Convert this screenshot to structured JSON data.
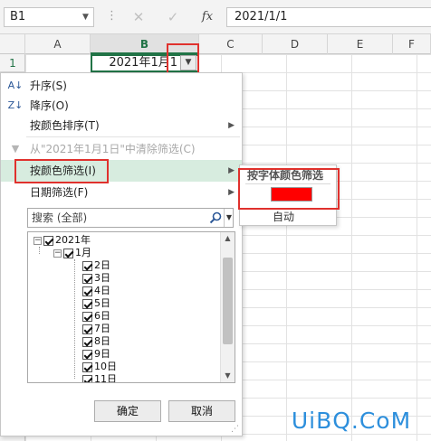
{
  "formula_bar": {
    "name_box": "B1",
    "dots": "⋮",
    "cancel_glyph": "✕",
    "confirm_glyph": "✓",
    "fx_label": "fx",
    "formula_value": "2021/1/1"
  },
  "sheet": {
    "columns": [
      "A",
      "B",
      "C",
      "D",
      "E",
      "F"
    ],
    "selected_column": "B",
    "rows": [
      "1"
    ],
    "active_cell_value": "2021年1月1"
  },
  "dropdown": {
    "items": [
      {
        "label": "升序(S)",
        "icon": "sort-ascending-icon",
        "glyph": "A↓"
      },
      {
        "label": "降序(O)",
        "icon": "sort-descending-icon",
        "glyph": "Z↓"
      },
      {
        "label": "按颜色排序(T)"
      },
      {
        "label": "从\"2021年1月1日\"中清除筛选(C)",
        "icon": "clear-filter-icon",
        "glyph": "▼",
        "disabled": true
      },
      {
        "label": "按颜色筛选(I)",
        "highlighted": true
      },
      {
        "label": "日期筛选(F)"
      }
    ],
    "search_placeholder": "搜索 (全部)",
    "tree": {
      "year": "2021年",
      "month": "1月",
      "days": [
        "2日",
        "3日",
        "4日",
        "5日",
        "6日",
        "7日",
        "8日",
        "9日",
        "10日",
        "11日"
      ]
    },
    "ok_label": "确定",
    "cancel_label": "取消"
  },
  "submenu": {
    "title": "按字体颜色筛选",
    "swatch_color": "#ff0000",
    "auto_label": "自动"
  },
  "watermark": "UiBQ.CoM",
  "colors": {
    "highlight_box": "#e0312d",
    "excel_green": "#217346",
    "hover_green": "#d7ecdf"
  }
}
